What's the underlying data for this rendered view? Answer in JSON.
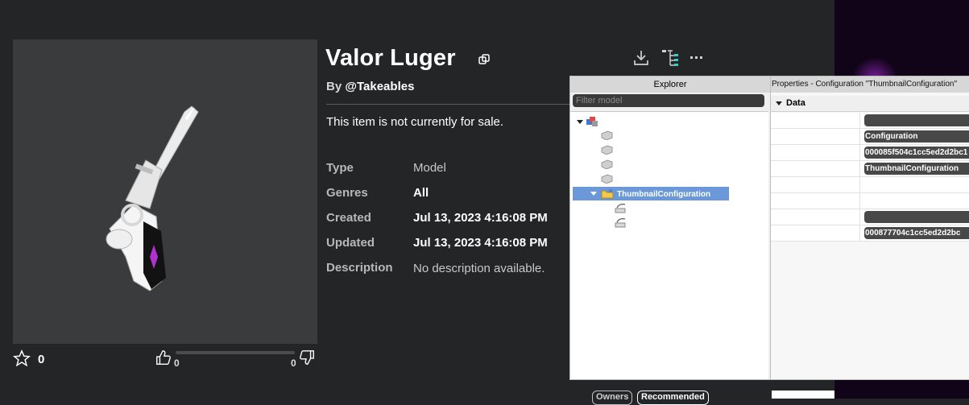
{
  "item": {
    "title": "Valor Luger",
    "by_prefix": "By",
    "creator": "@Takeables",
    "sale_status": "This item is not currently for sale.",
    "details": [
      {
        "label": "Type",
        "value": "Model"
      },
      {
        "label": "Genres",
        "value": "All"
      },
      {
        "label": "Created",
        "value": "Jul 13, 2023 4:16:08 PM"
      },
      {
        "label": "Updated",
        "value": "Jul 13, 2023 4:16:08 PM"
      },
      {
        "label": "Description",
        "value": "No description available."
      }
    ]
  },
  "rating": {
    "favorites": "0",
    "upvotes": "0",
    "downvotes": "0"
  },
  "explorer": {
    "title": "Explorer",
    "filter_placeholder": "Filter model",
    "selected_item": "ThumbnailConfiguration"
  },
  "properties": {
    "title": "Properties - Configuration \"ThumbnailConfiguration\"",
    "section": "Data",
    "values": [
      "",
      "Configuration",
      "000085f504c1cc5ed2d2bc1",
      "ThumbnailConfiguration",
      "000877704c1cc5ed2d2bc"
    ]
  },
  "tabs": [
    "Owners",
    "Recommended"
  ],
  "colors": {
    "background": "#232527",
    "thumbnail_bg": "#393b3d",
    "selection": "#6a98d8",
    "accent_gem": "#b030d0"
  },
  "icons": [
    "copy-icon",
    "download-icon",
    "tree-icon",
    "more-icon",
    "star-icon",
    "thumb-up-icon",
    "thumb-down-icon"
  ]
}
